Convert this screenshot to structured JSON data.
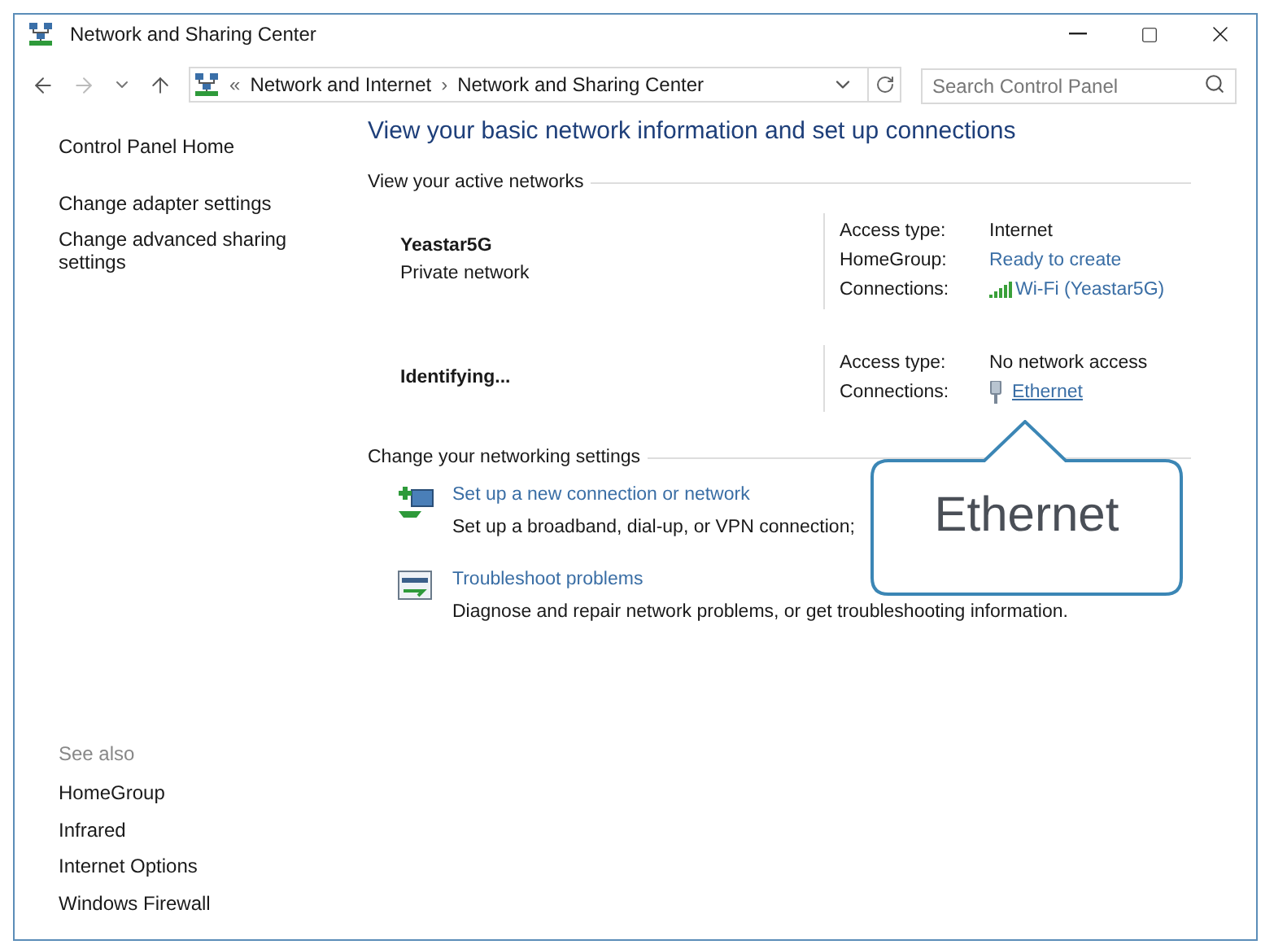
{
  "window": {
    "title": "Network and Sharing Center"
  },
  "address": {
    "overflow": "«",
    "separator": "›",
    "path": [
      "Network and Internet",
      "Network and Sharing Center"
    ]
  },
  "search": {
    "placeholder": "Search Control Panel"
  },
  "sidebar": {
    "items": [
      {
        "label": "Control Panel Home"
      },
      {
        "label": "Change adapter settings"
      },
      {
        "label": "Change advanced sharing settings"
      }
    ],
    "see_also": {
      "heading": "See also",
      "items": [
        "HomeGroup",
        "Infrared",
        "Internet Options",
        "Windows Firewall"
      ]
    }
  },
  "heading": "View your basic network information and set up connections",
  "active_networks": {
    "heading": "View your active networks",
    "networks": [
      {
        "name": "Yeastar5G",
        "type": "Private network",
        "details": [
          {
            "label": "Access type:",
            "value": "Internet",
            "kind": "text"
          },
          {
            "label": "HomeGroup:",
            "value": "Ready to create",
            "kind": "link"
          },
          {
            "label": "Connections:",
            "value": "Wi-Fi (Yeastar5G)",
            "kind": "wifi"
          }
        ]
      },
      {
        "name": "Identifying...",
        "details": [
          {
            "label": "Access type:",
            "value": "No network access",
            "kind": "text"
          },
          {
            "label": "Connections:",
            "value": "Ethernet",
            "kind": "ethernet"
          }
        ]
      }
    ]
  },
  "change_settings": {
    "heading": "Change your networking settings",
    "tasks": [
      {
        "title": "Set up a new connection or network",
        "description": "Set up a broadband, dial-up, or VPN connection;",
        "kind": "setup"
      },
      {
        "title": "Troubleshoot problems",
        "description": "Diagnose and repair network problems, or get troubleshooting information.",
        "kind": "troubleshoot"
      }
    ]
  },
  "callout": {
    "text": "Ethernet"
  }
}
